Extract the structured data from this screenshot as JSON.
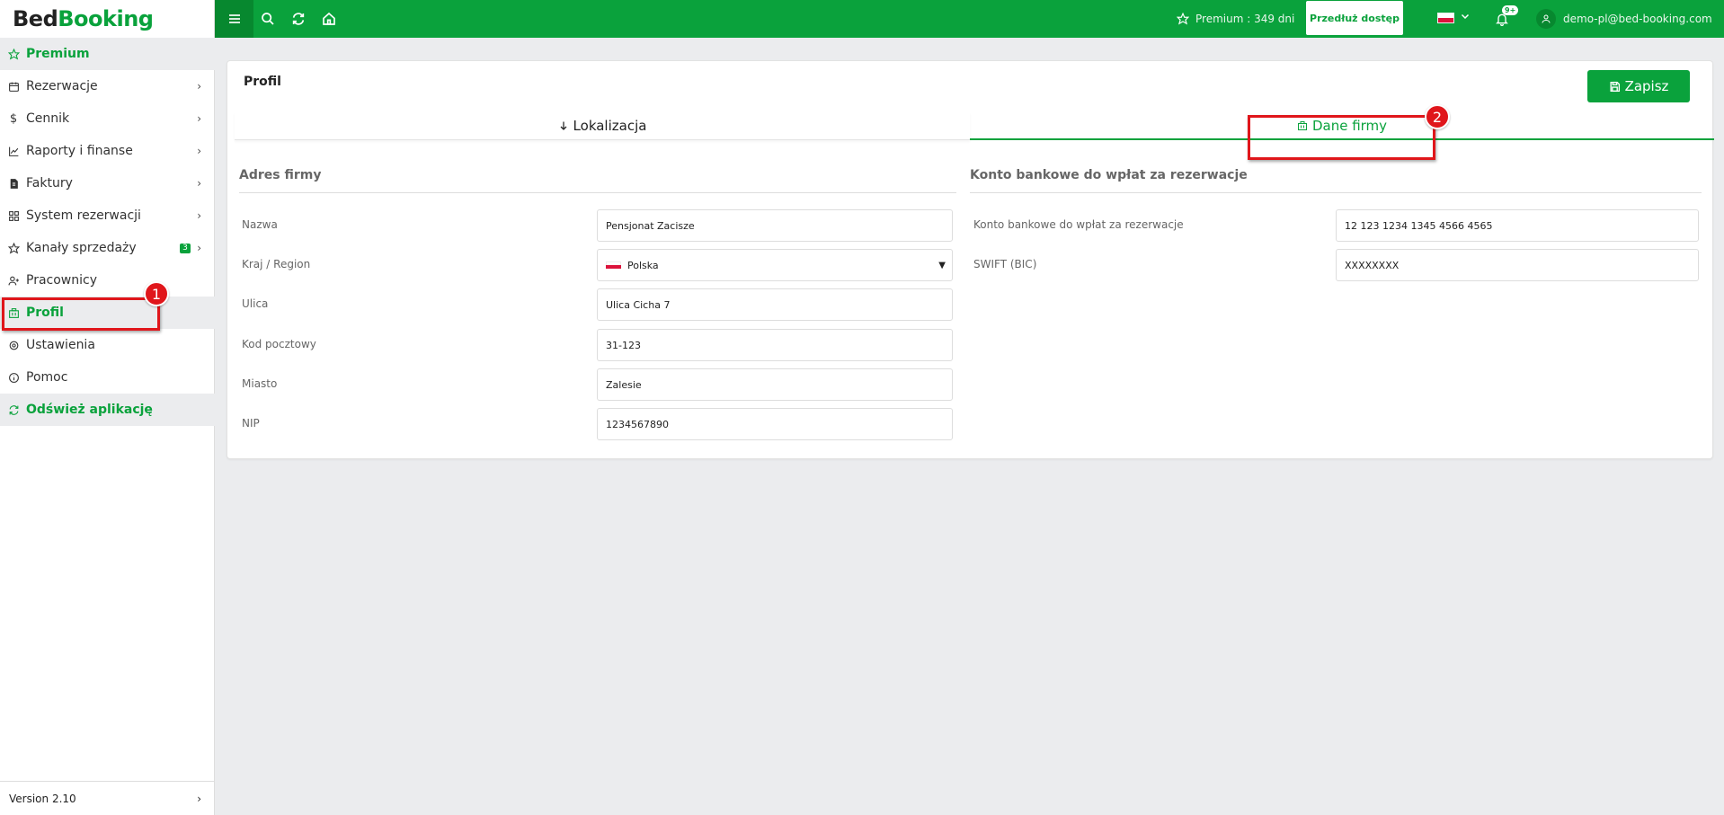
{
  "brand": {
    "part1": "Bed",
    "part2": "Booking"
  },
  "sidebar": {
    "items": [
      {
        "label": "Premium",
        "icon": "star-icon"
      },
      {
        "label": "Rezerwacje",
        "icon": "calendar-icon"
      },
      {
        "label": "Cennik",
        "icon": "dollar-icon"
      },
      {
        "label": "Raporty i finanse",
        "icon": "chart-icon"
      },
      {
        "label": "Faktury",
        "icon": "invoice-icon"
      },
      {
        "label": "System rezerwacji",
        "icon": "grid-icon"
      },
      {
        "label": "Kanały sprzedaży",
        "icon": "star-icon",
        "badge": "3"
      },
      {
        "label": "Pracownicy",
        "icon": "user-plus-icon"
      },
      {
        "label": "Profil",
        "icon": "building-icon"
      },
      {
        "label": "Ustawienia",
        "icon": "gear-icon"
      },
      {
        "label": "Pomoc",
        "icon": "info-icon"
      },
      {
        "label": "Odśwież aplikację",
        "icon": "refresh-icon"
      }
    ],
    "version": "Version 2.10"
  },
  "topbar": {
    "premium_text": "Premium : 349 dni",
    "extend_label": "Przedłuż dostęp",
    "notifications_badge": "9+",
    "user_email": "demo-pl@bed-booking.com"
  },
  "page": {
    "title": "Profil",
    "save_label": "Zapisz",
    "tabs": [
      {
        "label": "Lokalizacja"
      },
      {
        "label": "Dane firmy"
      }
    ],
    "address": {
      "title": "Adres firmy",
      "fields": [
        {
          "label": "Nazwa",
          "value": "Pensjonat Zacisze"
        },
        {
          "label": "Kraj / Region",
          "value": "Polska"
        },
        {
          "label": "Ulica",
          "value": "Ulica Cicha 7"
        },
        {
          "label": "Kod pocztowy",
          "value": "31-123"
        },
        {
          "label": "Miasto",
          "value": "Zalesie"
        },
        {
          "label": "NIP",
          "value": "1234567890"
        }
      ]
    },
    "bank": {
      "title": "Konto bankowe do wpłat za rezerwacje",
      "fields": [
        {
          "label": "Konto bankowe do wpłat za rezerwacje",
          "value": "12 123 1234 1345 4566 4565"
        },
        {
          "label": "SWIFT (BIC)",
          "value": "XXXXXXXX"
        }
      ]
    }
  },
  "annotations": [
    "1",
    "2"
  ],
  "colors": {
    "brand_green": "#0aa23c",
    "highlight_red": "#e0161b"
  }
}
